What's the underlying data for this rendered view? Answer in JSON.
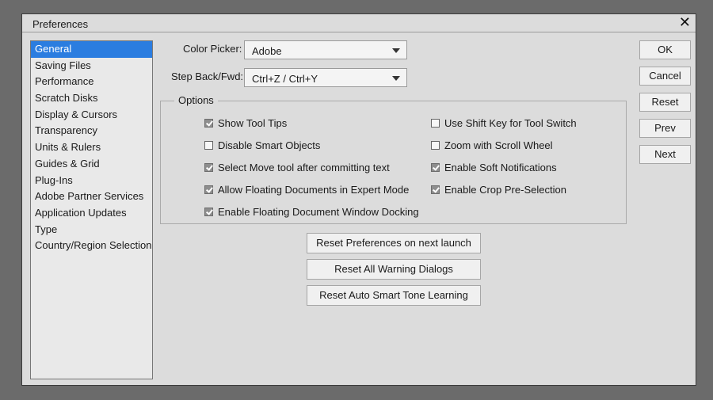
{
  "dialog": {
    "title": "Preferences",
    "close_glyph": "✕"
  },
  "sidebar": {
    "items": [
      {
        "label": "General",
        "selected": true
      },
      {
        "label": "Saving Files"
      },
      {
        "label": "Performance"
      },
      {
        "label": "Scratch Disks"
      },
      {
        "label": "Display & Cursors"
      },
      {
        "label": "Transparency"
      },
      {
        "label": "Units & Rulers"
      },
      {
        "label": "Guides & Grid"
      },
      {
        "label": "Plug-Ins"
      },
      {
        "label": "Adobe Partner Services"
      },
      {
        "label": "Application Updates"
      },
      {
        "label": "Type"
      },
      {
        "label": "Country/Region Selection"
      }
    ]
  },
  "fields": {
    "color_picker": {
      "label": "Color Picker:",
      "value": "Adobe"
    },
    "step_back": {
      "label": "Step Back/Fwd:",
      "value": "Ctrl+Z / Ctrl+Y"
    }
  },
  "options": {
    "title": "Options",
    "left": [
      {
        "label": "Show Tool Tips",
        "checked": true
      },
      {
        "label": "Disable Smart Objects",
        "checked": false
      },
      {
        "label": "Select Move tool after committing text",
        "checked": true
      },
      {
        "label": "Allow Floating Documents in Expert Mode",
        "checked": true
      },
      {
        "label": "Enable Floating Document Window Docking",
        "checked": true
      }
    ],
    "right": [
      {
        "label": "Use Shift Key for Tool Switch",
        "checked": false
      },
      {
        "label": "Zoom with Scroll Wheel",
        "checked": false
      },
      {
        "label": "Enable Soft Notifications",
        "checked": true
      },
      {
        "label": "Enable Crop Pre-Selection",
        "checked": true
      }
    ]
  },
  "reset_buttons": {
    "prefs": "Reset Preferences on next launch",
    "warnings": "Reset All Warning Dialogs",
    "smart_tone": "Reset Auto Smart Tone Learning"
  },
  "side_buttons": {
    "ok": "OK",
    "cancel": "Cancel",
    "reset": "Reset",
    "prev": "Prev",
    "next": "Next"
  }
}
